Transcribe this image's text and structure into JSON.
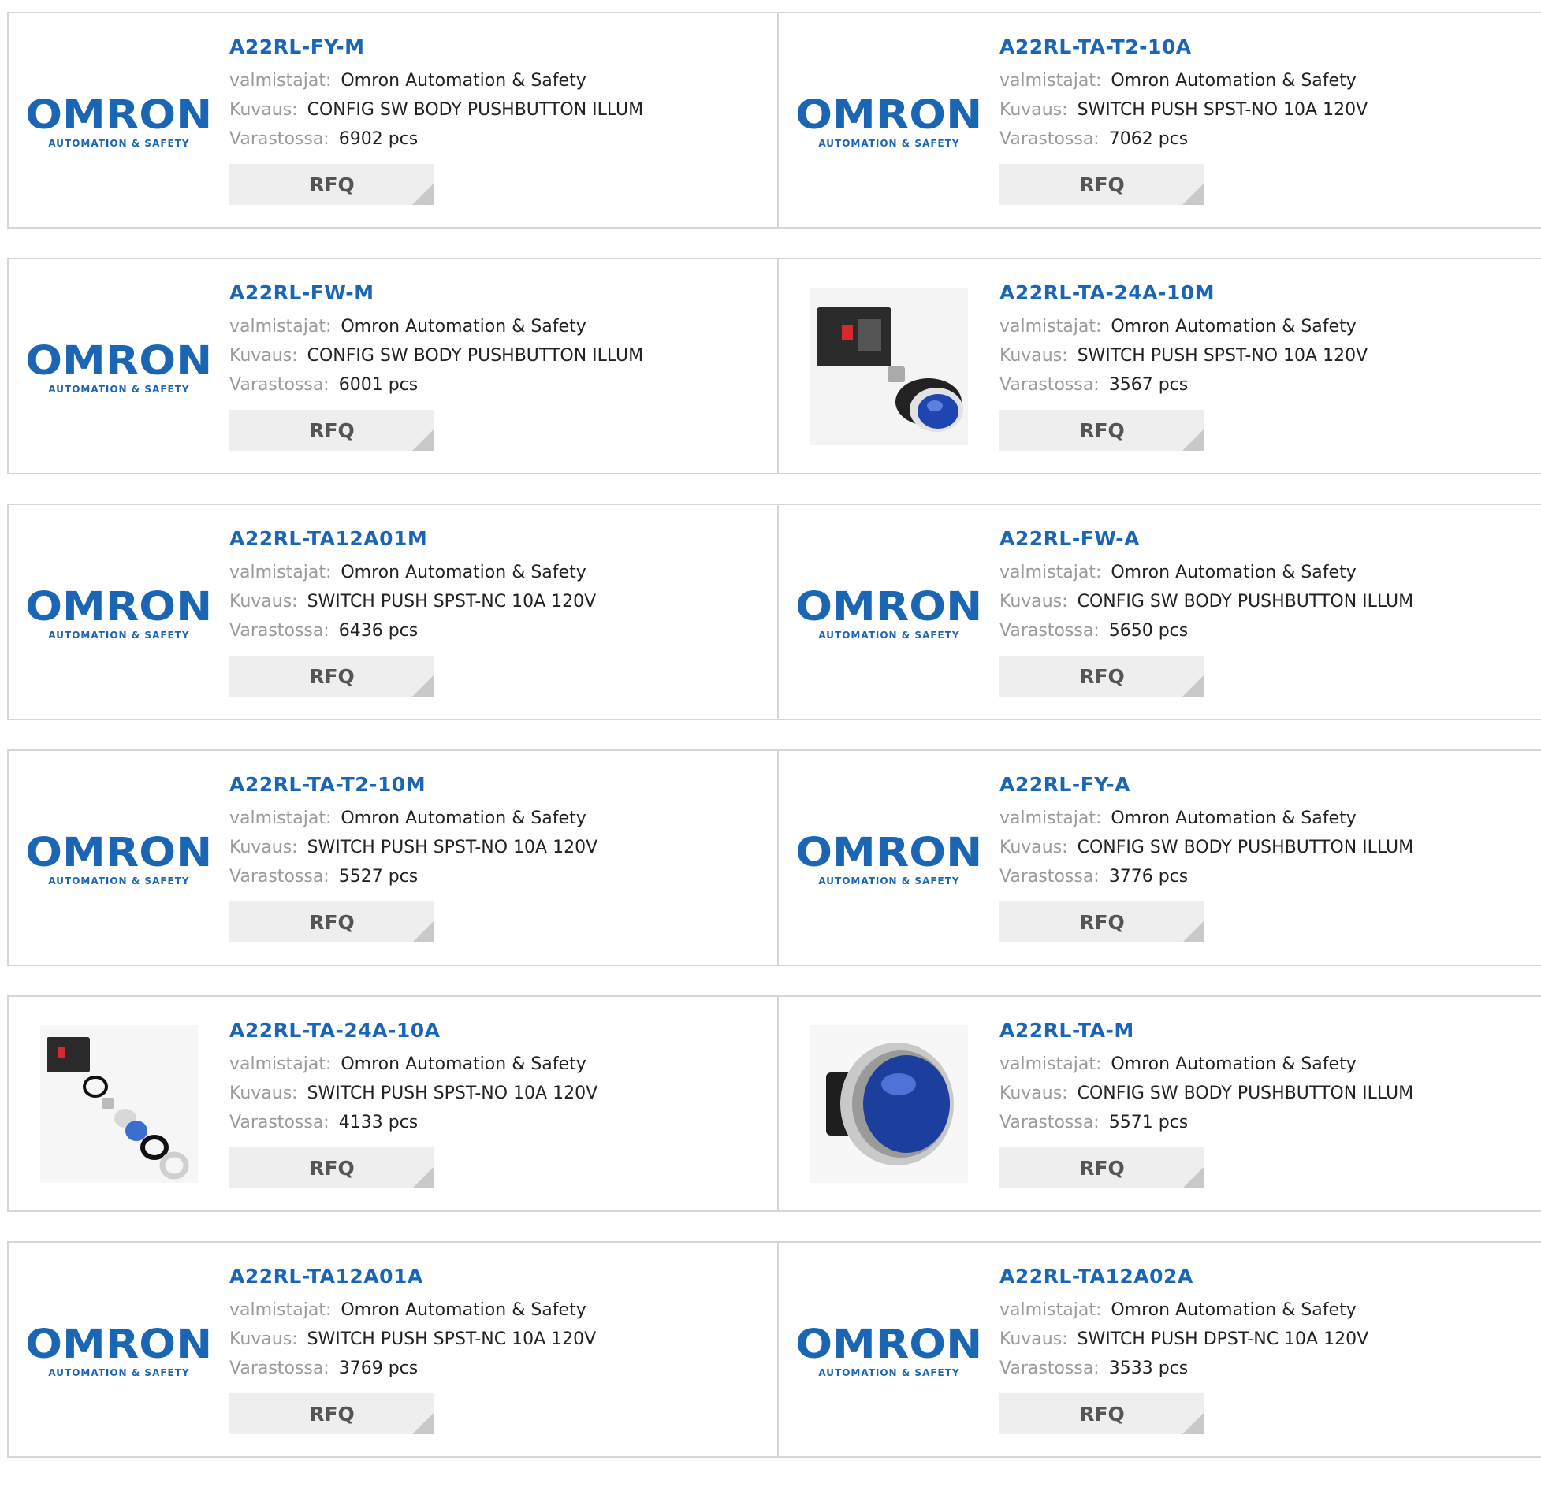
{
  "labels": {
    "manufacturer": "valmistajat:",
    "description": "Kuvaus:",
    "stock": "Varastossa:",
    "rfq": "RFQ"
  },
  "logo": {
    "word": "OMRON",
    "tagline": "AUTOMATION & SAFETY"
  },
  "products": [
    {
      "part": "A22RL-FY-M",
      "manufacturer": "Omron Automation & Safety",
      "description": "CONFIG SW BODY PUSHBUTTON ILLUM",
      "stock": "6902 pcs",
      "image": "omron-logo"
    },
    {
      "part": "A22RL-TA-T2-10A",
      "manufacturer": "Omron Automation & Safety",
      "description": "SWITCH PUSH SPST-NO 10A 120V",
      "stock": "7062 pcs",
      "image": "omron-logo"
    },
    {
      "part": "A22RL-FW-M",
      "manufacturer": "Omron Automation & Safety",
      "description": "CONFIG SW BODY PUSHBUTTON ILLUM",
      "stock": "6001 pcs",
      "image": "omron-logo"
    },
    {
      "part": "A22RL-TA-24A-10M",
      "manufacturer": "Omron Automation & Safety",
      "description": "SWITCH PUSH SPST-NO 10A 120V",
      "stock": "3567 pcs",
      "image": "pushbutton-assembly-photo"
    },
    {
      "part": "A22RL-TA12A01M",
      "manufacturer": "Omron Automation & Safety",
      "description": "SWITCH PUSH SPST-NC 10A 120V",
      "stock": "6436 pcs",
      "image": "omron-logo"
    },
    {
      "part": "A22RL-FW-A",
      "manufacturer": "Omron Automation & Safety",
      "description": "CONFIG SW BODY PUSHBUTTON ILLUM",
      "stock": "5650 pcs",
      "image": "omron-logo"
    },
    {
      "part": "A22RL-TA-T2-10M",
      "manufacturer": "Omron Automation & Safety",
      "description": "SWITCH PUSH SPST-NO 10A 120V",
      "stock": "5527 pcs",
      "image": "omron-logo"
    },
    {
      "part": "A22RL-FY-A",
      "manufacturer": "Omron Automation & Safety",
      "description": "CONFIG SW BODY PUSHBUTTON ILLUM",
      "stock": "3776 pcs",
      "image": "omron-logo"
    },
    {
      "part": "A22RL-TA-24A-10A",
      "manufacturer": "Omron Automation & Safety",
      "description": "SWITCH PUSH SPST-NO 10A 120V",
      "stock": "4133 pcs",
      "image": "pushbutton-exploded-photo"
    },
    {
      "part": "A22RL-TA-M",
      "manufacturer": "Omron Automation & Safety",
      "description": "CONFIG SW BODY PUSHBUTTON ILLUM",
      "stock": "5571 pcs",
      "image": "blue-pushbutton-photo"
    },
    {
      "part": "A22RL-TA12A01A",
      "manufacturer": "Omron Automation & Safety",
      "description": "SWITCH PUSH SPST-NC 10A 120V",
      "stock": "3769 pcs",
      "image": "omron-logo"
    },
    {
      "part": "A22RL-TA12A02A",
      "manufacturer": "Omron Automation & Safety",
      "description": "SWITCH PUSH DPST-NC 10A 120V",
      "stock": "3533 pcs",
      "image": "omron-logo"
    }
  ],
  "colors": {
    "link": "#1a66b5",
    "label": "#9a9a9a",
    "border": "#d6d6d6",
    "button": "#eeeeee"
  }
}
